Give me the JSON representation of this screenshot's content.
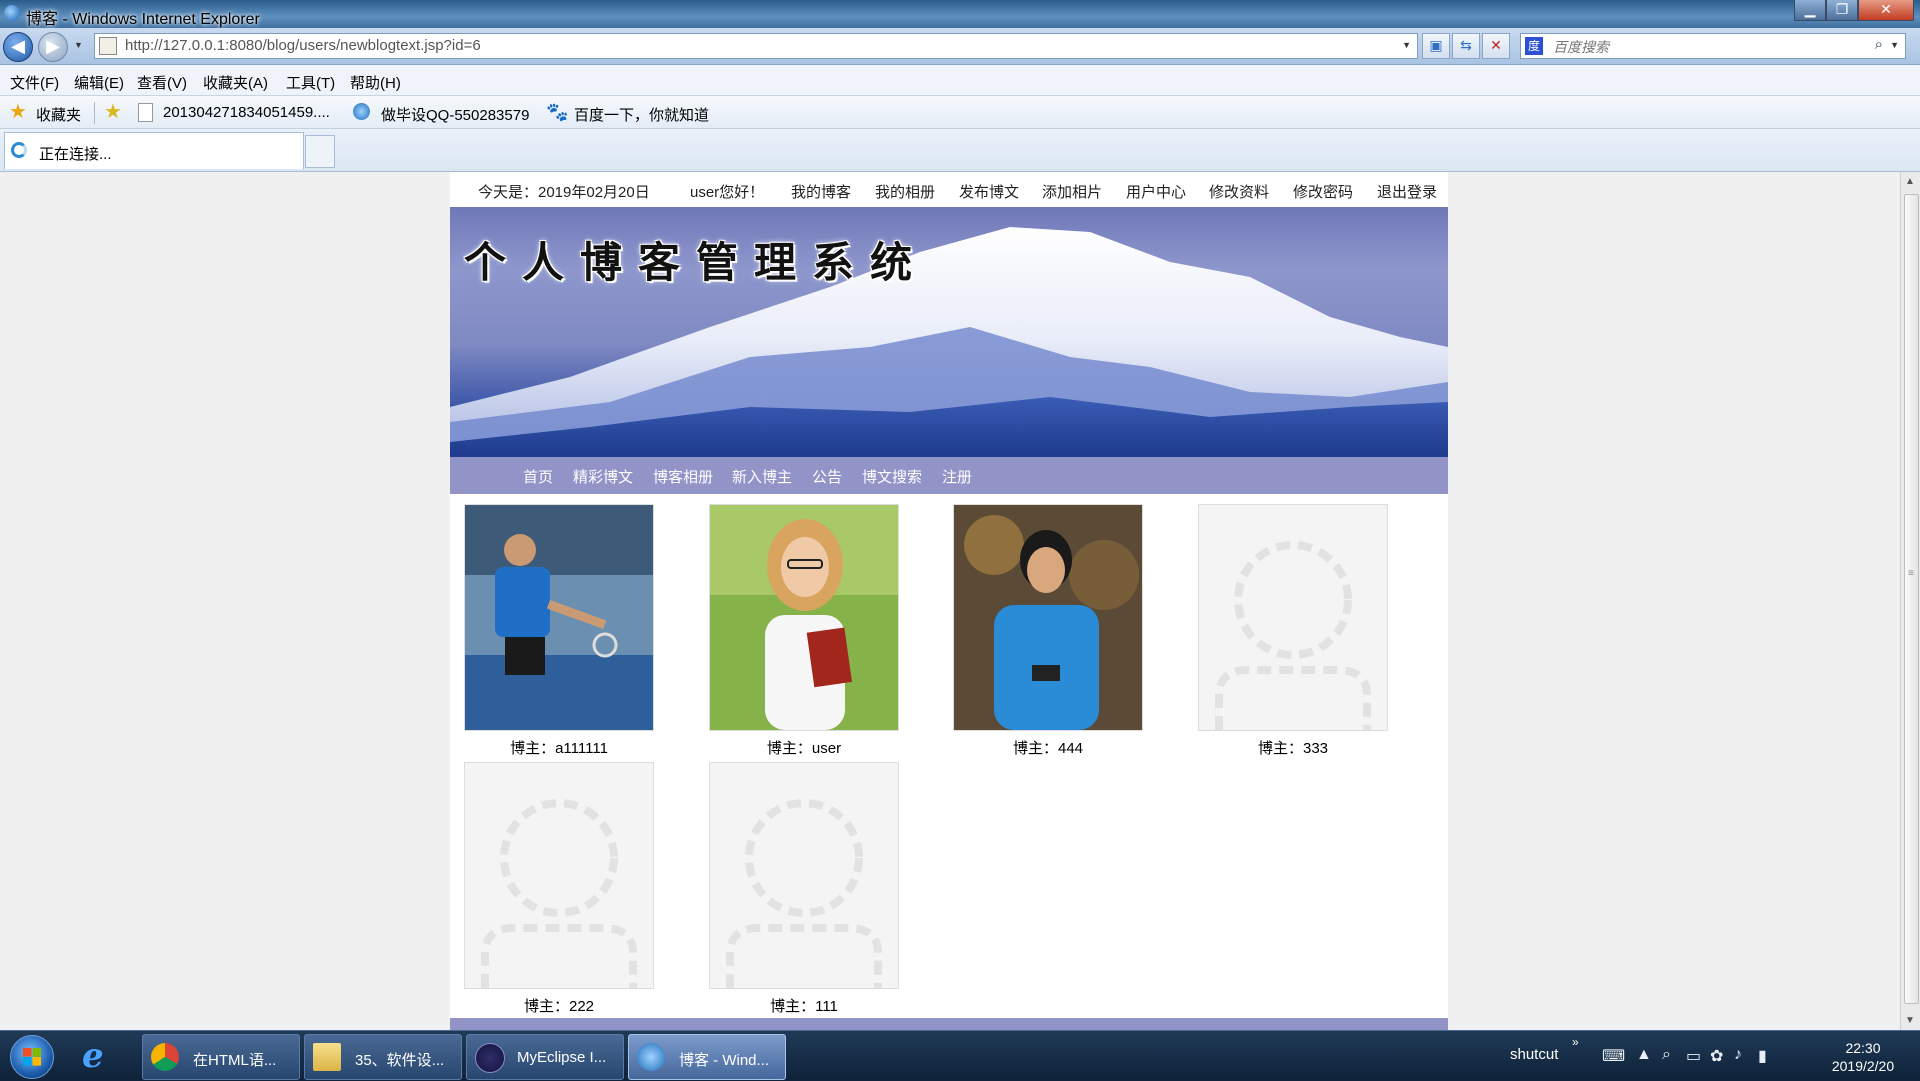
{
  "window": {
    "title": "博客 - Windows Internet Explorer"
  },
  "address_bar": {
    "url": "http://127.0.0.1:8080/blog/users/newblogtext.jsp?id=6",
    "search_placeholder": "百度搜索"
  },
  "menu": [
    "文件(F)",
    "编辑(E)",
    "查看(V)",
    "收藏夹(A)",
    "工具(T)",
    "帮助(H)"
  ],
  "favorites": {
    "label": "收藏夹",
    "items": [
      "201304271834051459....",
      "做毕设QQ-550283579",
      "百度一下，你就知道"
    ]
  },
  "tab": {
    "label": "正在连接..."
  },
  "page": {
    "top_nav": {
      "date_text": "今天是：2019年02月20日",
      "greeting": "user您好！",
      "links": [
        "我的博客",
        "我的相册",
        "发布博文",
        "添加相片",
        "用户中心",
        "修改资料",
        "修改密码",
        "退出登录"
      ]
    },
    "banner_title": "个人博客管理系统",
    "main_nav": [
      "首页",
      "精彩博文",
      "博客相册",
      "新入博主",
      "公告",
      "博文搜索",
      "注册"
    ],
    "bloggers": [
      {
        "caption": "博主：a111111",
        "photo": "badminton-player-photo"
      },
      {
        "caption": "博主：user",
        "photo": "woman-with-books-photo"
      },
      {
        "caption": "博主：444",
        "photo": "young-man-with-phone-photo"
      },
      {
        "caption": "博主：333",
        "photo": "default-avatar"
      },
      {
        "caption": "博主：222",
        "photo": "default-avatar"
      },
      {
        "caption": "博主：111",
        "photo": "default-avatar"
      }
    ]
  },
  "taskbar": {
    "tasks": [
      "在HTML语...",
      "35、软件设...",
      "MyEclipse I...",
      "博客 - Wind..."
    ],
    "tray_label": "shutcut",
    "time": "22:30",
    "date": "2019/2/20"
  },
  "colors": {
    "nav_bar": "#9294c8",
    "content_bg": "#f0f0f0",
    "taskbar": "#14263d"
  }
}
